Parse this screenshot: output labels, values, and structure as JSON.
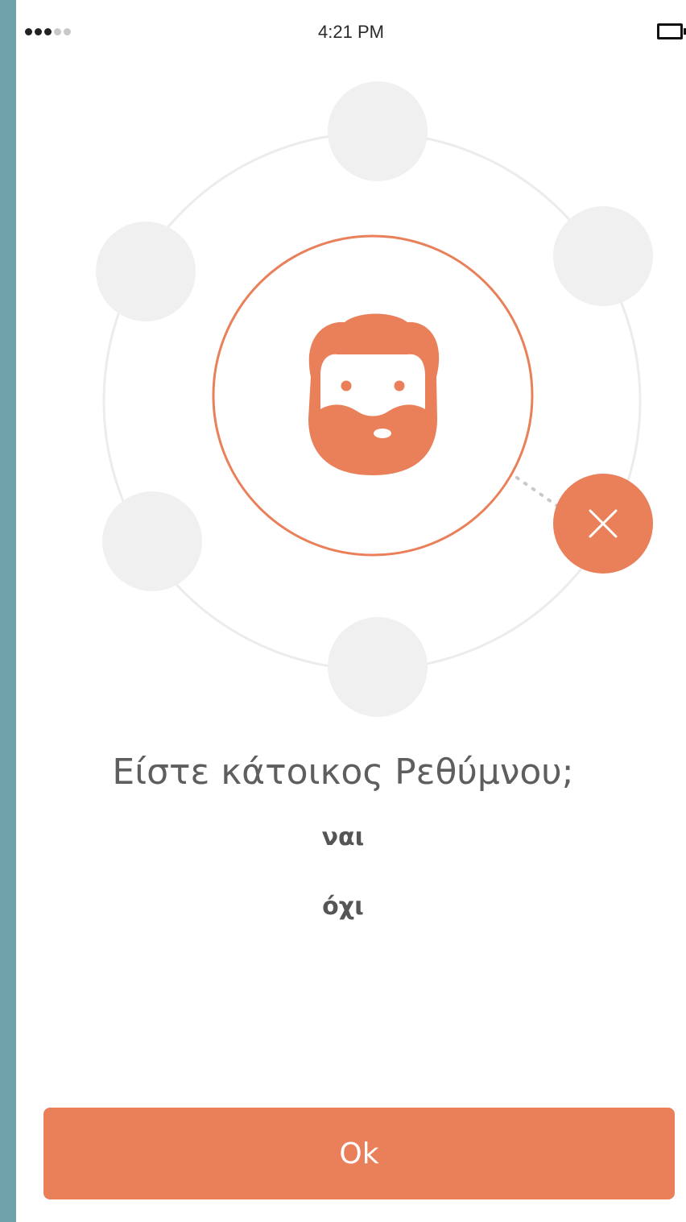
{
  "status_bar": {
    "time": "4:21 PM",
    "signal_bars_filled": 3,
    "signal_bars_total": 5
  },
  "illustration": {
    "center_icon": "bearded-man-face-icon",
    "badge_icon": "close-icon",
    "accent_color": "#e9805a",
    "placeholder_color": "#f0f0f0"
  },
  "question": {
    "text": "Είστε κάτοικος Ρεθύμνου;",
    "options": [
      "ναι",
      "όχι"
    ]
  },
  "ok_button": {
    "label": "Ok",
    "color": "#e9805a"
  }
}
